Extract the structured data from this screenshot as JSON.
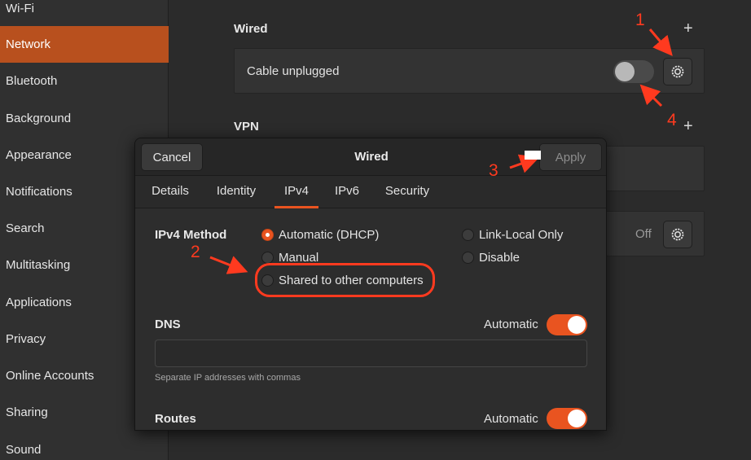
{
  "sidebar": {
    "items": [
      {
        "label": "Wi-Fi",
        "active": false
      },
      {
        "label": "Network",
        "active": true
      },
      {
        "label": "Bluetooth",
        "active": false
      },
      {
        "label": "Background",
        "active": false
      },
      {
        "label": "Appearance",
        "active": false
      },
      {
        "label": "Notifications",
        "active": false
      },
      {
        "label": "Search",
        "active": false
      },
      {
        "label": "Multitasking",
        "active": false
      },
      {
        "label": "Applications",
        "active": false
      },
      {
        "label": "Privacy",
        "active": false
      },
      {
        "label": "Online Accounts",
        "active": false
      },
      {
        "label": "Sharing",
        "active": false
      },
      {
        "label": "Sound",
        "active": false
      }
    ]
  },
  "main": {
    "wired_title": "Wired",
    "wired_status": "Cable unplugged",
    "vpn_title": "VPN",
    "proxy_status": "Off"
  },
  "dialog": {
    "cancel_label": "Cancel",
    "title": "Wired",
    "apply_label": "Apply",
    "tabs": [
      {
        "label": "Details"
      },
      {
        "label": "Identity"
      },
      {
        "label": "IPv4",
        "active": true
      },
      {
        "label": "IPv6"
      },
      {
        "label": "Security"
      }
    ],
    "ipv4_method_label": "IPv4 Method",
    "methods": {
      "automatic": "Automatic (DHCP)",
      "manual": "Manual",
      "shared": "Shared to other computers",
      "link_local": "Link-Local Only",
      "disable": "Disable"
    },
    "selected_method": "Automatic (DHCP)",
    "dns_label": "DNS",
    "dns_automatic_label": "Automatic",
    "dns_automatic_on": true,
    "dns_value": "",
    "dns_hint": "Separate IP addresses with commas",
    "routes_label": "Routes",
    "routes_automatic_label": "Automatic",
    "routes_automatic_on": true
  },
  "annotations": {
    "n1": "1",
    "n2": "2",
    "n3": "3",
    "n4": "4"
  },
  "colors": {
    "accent": "#e95420",
    "sidebar_active": "#b8501e",
    "annotation": "#ff3a1f"
  },
  "icons": {
    "wired_settings": "gear-icon",
    "proxy_settings": "gear-icon",
    "add": "plus-icon"
  }
}
